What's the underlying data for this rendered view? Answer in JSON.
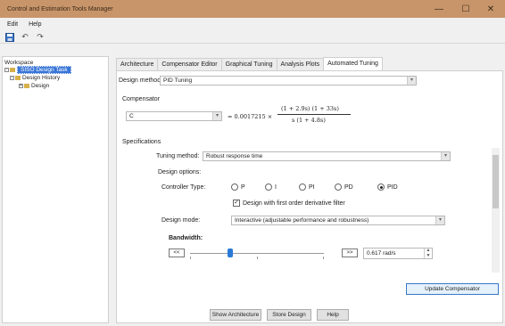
{
  "window": {
    "title": "Control and Estimation Tools Manager",
    "min_label": "—",
    "max_label": "☐",
    "close_label": "✕"
  },
  "menu": [
    "Edit",
    "Help"
  ],
  "toolbar": {
    "icons": [
      "save-icon",
      "undo-icon",
      "redo-icon"
    ]
  },
  "tree": {
    "root": "Workspace",
    "task": "SISO Design Task",
    "history": "Design History",
    "design": "Design"
  },
  "tabs": [
    {
      "label": "Architecture",
      "active": false
    },
    {
      "label": "Compensator Editor",
      "active": false
    },
    {
      "label": "Graphical Tuning",
      "active": false
    },
    {
      "label": "Analysis Plots",
      "active": false
    },
    {
      "label": "Automated Tuning",
      "active": true
    }
  ],
  "design_method": {
    "label": "Design method:",
    "value": "PID Tuning"
  },
  "compensator": {
    "section_label": "Compensator",
    "selector_value": "C",
    "equals": "= 0.0017215 ×",
    "numerator": "(1 + 2.9s) (1 + 33s)",
    "denominator": "s (1 + 4.8s)"
  },
  "specifications": {
    "section_label": "Specifications",
    "tuning_method_label": "Tuning method:",
    "tuning_method_value": "Robust response time",
    "design_options_label": "Design options:",
    "controller_type_label": "Controller Type:",
    "controller_types": [
      {
        "label": "P",
        "selected": false
      },
      {
        "label": "I",
        "selected": false
      },
      {
        "label": "PI",
        "selected": false
      },
      {
        "label": "PD",
        "selected": false
      },
      {
        "label": "PID",
        "selected": true
      }
    ],
    "filter_checkbox_label": "Design with first order derivative filter",
    "filter_checked": true,
    "design_mode_label": "Design mode:",
    "design_mode_value": "Interactive (adjustable performance and robustness)",
    "bandwidth_label": "Bandwidth:",
    "bandwidth_dec": "<<",
    "bandwidth_inc": ">>",
    "bandwidth_value": "0.617 rad/s",
    "bandwidth_slider_fraction": 0.3
  },
  "buttons": {
    "update": "Update Compensator",
    "show_arch": "Show Architecture",
    "store": "Store Design",
    "help": "Help"
  }
}
